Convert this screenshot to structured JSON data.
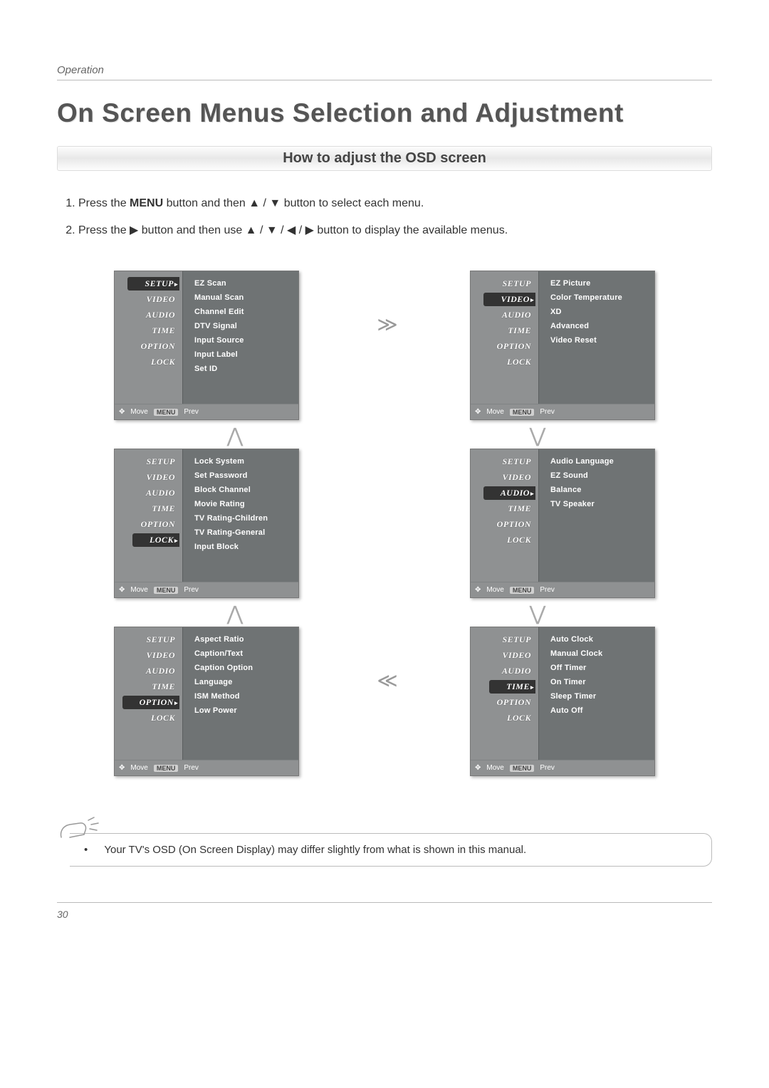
{
  "header": {
    "section_label": "Operation"
  },
  "title": "On Screen Menus Selection and Adjustment",
  "subtitle": "How to adjust the OSD screen",
  "steps": [
    {
      "pre": "Press the ",
      "bold": "MENU",
      "post": " button and then ▲ / ▼ button to select each menu."
    },
    {
      "pre": "Press the ▶ button and then use ▲ / ▼ / ◀ / ▶ button to display the available menus.",
      "bold": "",
      "post": ""
    }
  ],
  "sidebar_tabs": [
    "SETUP",
    "VIDEO",
    "AUDIO",
    "TIME",
    "OPTION",
    "LOCK"
  ],
  "panels": [
    {
      "id": "setup",
      "selected": "SETUP",
      "items": [
        "EZ Scan",
        "Manual Scan",
        "Channel Edit",
        "DTV Signal",
        "Input Source",
        "Input Label",
        "Set ID"
      ]
    },
    {
      "id": "video",
      "selected": "VIDEO",
      "items": [
        "EZ Picture",
        "Color Temperature",
        "XD",
        "Advanced",
        "Video Reset"
      ]
    },
    {
      "id": "lock",
      "selected": "LOCK",
      "items": [
        "Lock System",
        "Set Password",
        "Block Channel",
        "Movie Rating",
        "TV Rating-Children",
        "TV Rating-General",
        "Input Block"
      ]
    },
    {
      "id": "audio",
      "selected": "AUDIO",
      "items": [
        "Audio Language",
        "EZ Sound",
        "Balance",
        "TV Speaker"
      ]
    },
    {
      "id": "option",
      "selected": "OPTION",
      "items": [
        "Aspect Ratio",
        "Caption/Text",
        "Caption Option",
        "Language",
        "ISM Method",
        "Low Power"
      ]
    },
    {
      "id": "time",
      "selected": "TIME",
      "items": [
        "Auto Clock",
        "Manual Clock",
        "Off Timer",
        "On Timer",
        "Sleep Timer",
        "Auto Off"
      ]
    }
  ],
  "osd_footer": {
    "move_glyph": "✥",
    "move_label": "Move",
    "key_label": "MENU",
    "prev_label": "Prev"
  },
  "flow_arrows": {
    "right_top": "≫",
    "left_bottom": "≪",
    "down": "⋁",
    "up": "⋀"
  },
  "note": "Your TV's OSD (On Screen Display) may differ slightly from what is shown in this manual.",
  "page_number": "30"
}
